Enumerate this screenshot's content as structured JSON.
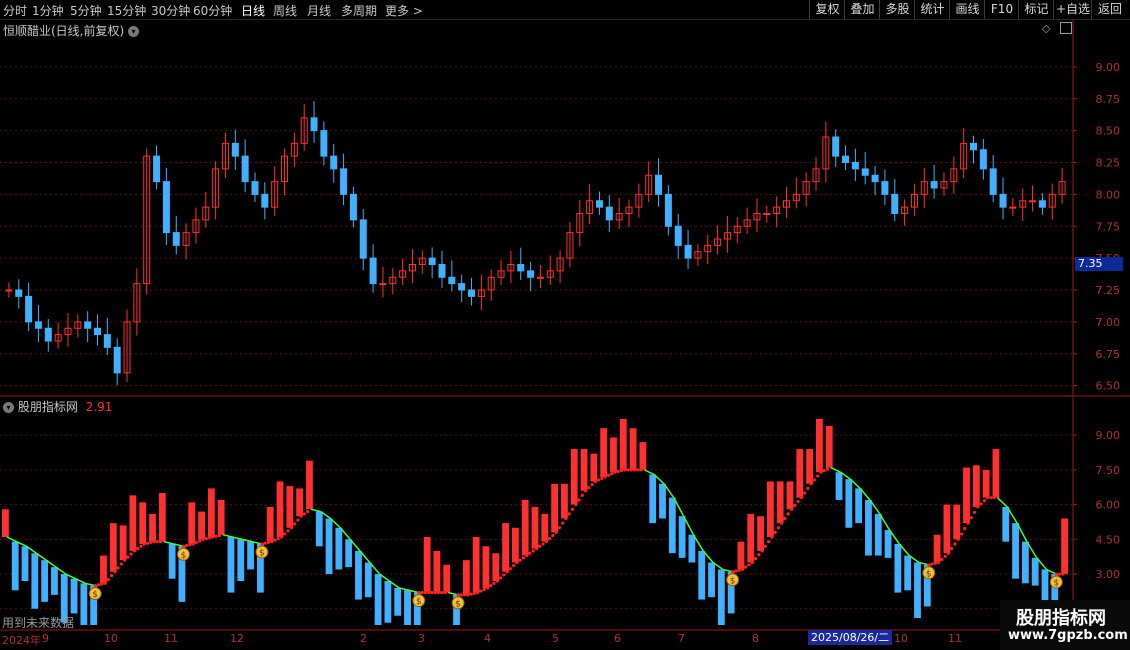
{
  "toolbar": {
    "timeframes": [
      "分时",
      "1分钟",
      "5分钟",
      "15分钟",
      "30分钟",
      "60分钟",
      "日线",
      "周线",
      "月线",
      "多周期",
      "更多 >"
    ],
    "active_timeframe": "日线",
    "right_buttons": [
      "复权",
      "叠加",
      "多股",
      "统计",
      "画线",
      "F10",
      "+自选",
      "返回"
    ],
    "mark_button": "标记"
  },
  "main_panel": {
    "title": "恒顺醋业(日线,前复权)",
    "price_tag": "7.35",
    "y_ticks": [
      "9.00",
      "8.75",
      "8.50",
      "8.25",
      "8.00",
      "7.50",
      "7.25",
      "7.00",
      "6.75",
      "6.50"
    ]
  },
  "indicator_panel": {
    "title": "股朋指标网",
    "value": "2.91",
    "y_ticks": [
      "9.00",
      "7.50",
      "6.00",
      "4.50",
      "3.00",
      "1.50"
    ],
    "future_note": "用到未来数据"
  },
  "x_axis": {
    "labels": [
      "2024年",
      "9",
      "10",
      "11",
      "12",
      "2",
      "3",
      "4",
      "5",
      "6",
      "7",
      "8",
      "9",
      "10",
      "11"
    ],
    "cursor_date": "2025/08/26/二"
  },
  "watermark": {
    "main": "股朋指标网",
    "sub": "www.7gpzb.com"
  },
  "colors": {
    "up": "#ff3030",
    "down": "#40b0ff",
    "ma": "#40ff40",
    "signal_up": "#ff2020",
    "orange": "#ffa020",
    "axis": "#a01818"
  },
  "chart_data": [
    {
      "type": "candlestick",
      "title": "恒顺醋业(日线,前复权)",
      "ylim": [
        6.45,
        9.25
      ],
      "y_ticks": [
        6.5,
        6.75,
        7.0,
        7.25,
        7.5,
        7.75,
        8.0,
        8.25,
        8.5,
        8.75,
        9.0
      ],
      "close": [
        7.25,
        7.2,
        7.0,
        6.95,
        6.85,
        6.9,
        6.95,
        7.0,
        6.95,
        6.9,
        6.8,
        6.6,
        7.0,
        7.3,
        8.3,
        8.1,
        7.7,
        7.6,
        7.7,
        7.8,
        7.9,
        8.2,
        8.4,
        8.3,
        8.1,
        8.0,
        7.9,
        8.1,
        8.3,
        8.4,
        8.6,
        8.5,
        8.3,
        8.2,
        8.0,
        7.8,
        7.5,
        7.3,
        7.3,
        7.35,
        7.4,
        7.45,
        7.5,
        7.45,
        7.35,
        7.3,
        7.25,
        7.2,
        7.25,
        7.35,
        7.4,
        7.45,
        7.4,
        7.35,
        7.35,
        7.4,
        7.5,
        7.7,
        7.85,
        7.95,
        7.9,
        7.8,
        7.85,
        7.9,
        8.0,
        8.15,
        8.0,
        7.75,
        7.6,
        7.5,
        7.55,
        7.6,
        7.65,
        7.7,
        7.75,
        7.8,
        7.85,
        7.85,
        7.9,
        7.95,
        8.0,
        8.1,
        8.2,
        8.45,
        8.3,
        8.25,
        8.2,
        8.15,
        8.1,
        8.0,
        7.85,
        7.9,
        8.0,
        8.1,
        8.05,
        8.1,
        8.2,
        8.4,
        8.35,
        8.2,
        8.0,
        7.9,
        7.9,
        7.95,
        7.95,
        7.9,
        8.0,
        8.1
      ]
    },
    {
      "type": "line",
      "title": "股朋指标网",
      "ylim": [
        0.8,
        10.0
      ],
      "y_ticks": [
        1.5,
        3.0,
        4.5,
        6.0,
        7.5,
        9.0
      ],
      "series": [
        {
          "values": [
            4.6,
            4.4,
            4.2,
            3.9,
            3.6,
            3.3,
            3.0,
            2.8,
            2.6,
            2.5,
            2.6,
            3.1,
            3.6,
            4.0,
            4.3,
            4.4,
            4.4,
            4.3,
            4.2,
            4.3,
            4.5,
            4.6,
            4.7,
            4.6,
            4.5,
            4.4,
            4.3,
            4.4,
            4.6,
            5.0,
            5.5,
            5.8,
            5.7,
            5.4,
            5.0,
            4.5,
            4.0,
            3.5,
            3.0,
            2.7,
            2.4,
            2.3,
            2.2,
            2.2,
            2.2,
            2.2,
            2.1,
            2.1,
            2.2,
            2.4,
            2.7,
            3.1,
            3.5,
            3.8,
            4.1,
            4.4,
            4.8,
            5.4,
            6.0,
            6.6,
            7.0,
            7.2,
            7.4,
            7.5,
            7.5,
            7.5,
            7.3,
            6.9,
            6.3,
            5.5,
            4.7,
            4.0,
            3.5,
            3.2,
            3.1,
            3.2,
            3.5,
            4.0,
            4.6,
            5.2,
            5.8,
            6.3,
            6.9,
            7.4,
            7.6,
            7.4,
            7.1,
            6.7,
            6.2,
            5.6,
            4.9,
            4.3,
            3.8,
            3.5,
            3.4,
            3.5,
            3.9,
            4.5,
            5.2,
            5.9,
            6.3,
            6.3,
            5.9,
            5.2,
            4.4,
            3.7,
            3.2,
            3.0,
            3.0
          ]
        }
      ],
      "colors_note": "line red when rising, green when falling"
    }
  ]
}
